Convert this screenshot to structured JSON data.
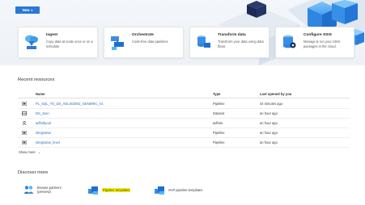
{
  "header": {
    "new_label": "New"
  },
  "cards": [
    {
      "title": "Ingest",
      "desc": "Copy data at scale once or on a schedule",
      "icon": "ingest-cloud-icon"
    },
    {
      "title": "Orchestrate",
      "desc": "Code-free data pipelines",
      "icon": "orchestrate-pipeline-icon"
    },
    {
      "title": "Transform data",
      "desc": "Transform your data using data flows",
      "icon": "transform-data-icon"
    },
    {
      "title": "Configure SSIS",
      "desc": "Manage & run your SSIS packages in the cloud.",
      "icon": "ssis-config-icon"
    }
  ],
  "recent": {
    "title": "Recent resources",
    "columns": {
      "name": "Name",
      "type": "Type",
      "opened": "Last opened by you"
    },
    "rows": [
      {
        "name": "PL_SQL_TO_DS_ADLSGEN2_GENERIC_V1",
        "type": "Pipeline",
        "opened": "44 minutes ago",
        "icon": "pipeline-icon"
      },
      {
        "name": "DS_Json",
        "type": "Dataset",
        "opened": "an hour ago",
        "icon": "dataset-icon"
      },
      {
        "name": "adfrollpool",
        "type": "adfrole",
        "opened": "an hour ago",
        "icon": "role-icon"
      },
      {
        "name": "integration",
        "type": "Pipeline",
        "opened": "an hour ago",
        "icon": "pipeline-icon"
      },
      {
        "name": "integration_level",
        "type": "Pipeline",
        "opened": "an hour ago",
        "icon": "pipeline-icon"
      }
    ],
    "show_more": "Show more"
  },
  "discover": {
    "title": "Discover more",
    "items": [
      {
        "label_line1": "Browse partners",
        "label_line2": "(preview)",
        "icon": "partners-icon"
      },
      {
        "label_line1": "Pipeline templates",
        "icon": "pipeline-templates-icon",
        "highlighted": true
      },
      {
        "label_line1": "SAP pipeline templates",
        "icon": "sap-templates-icon"
      }
    ]
  },
  "colors": {
    "accent": "#2b78d8",
    "link": "#2b6cbf",
    "highlight": "#f7f300"
  }
}
